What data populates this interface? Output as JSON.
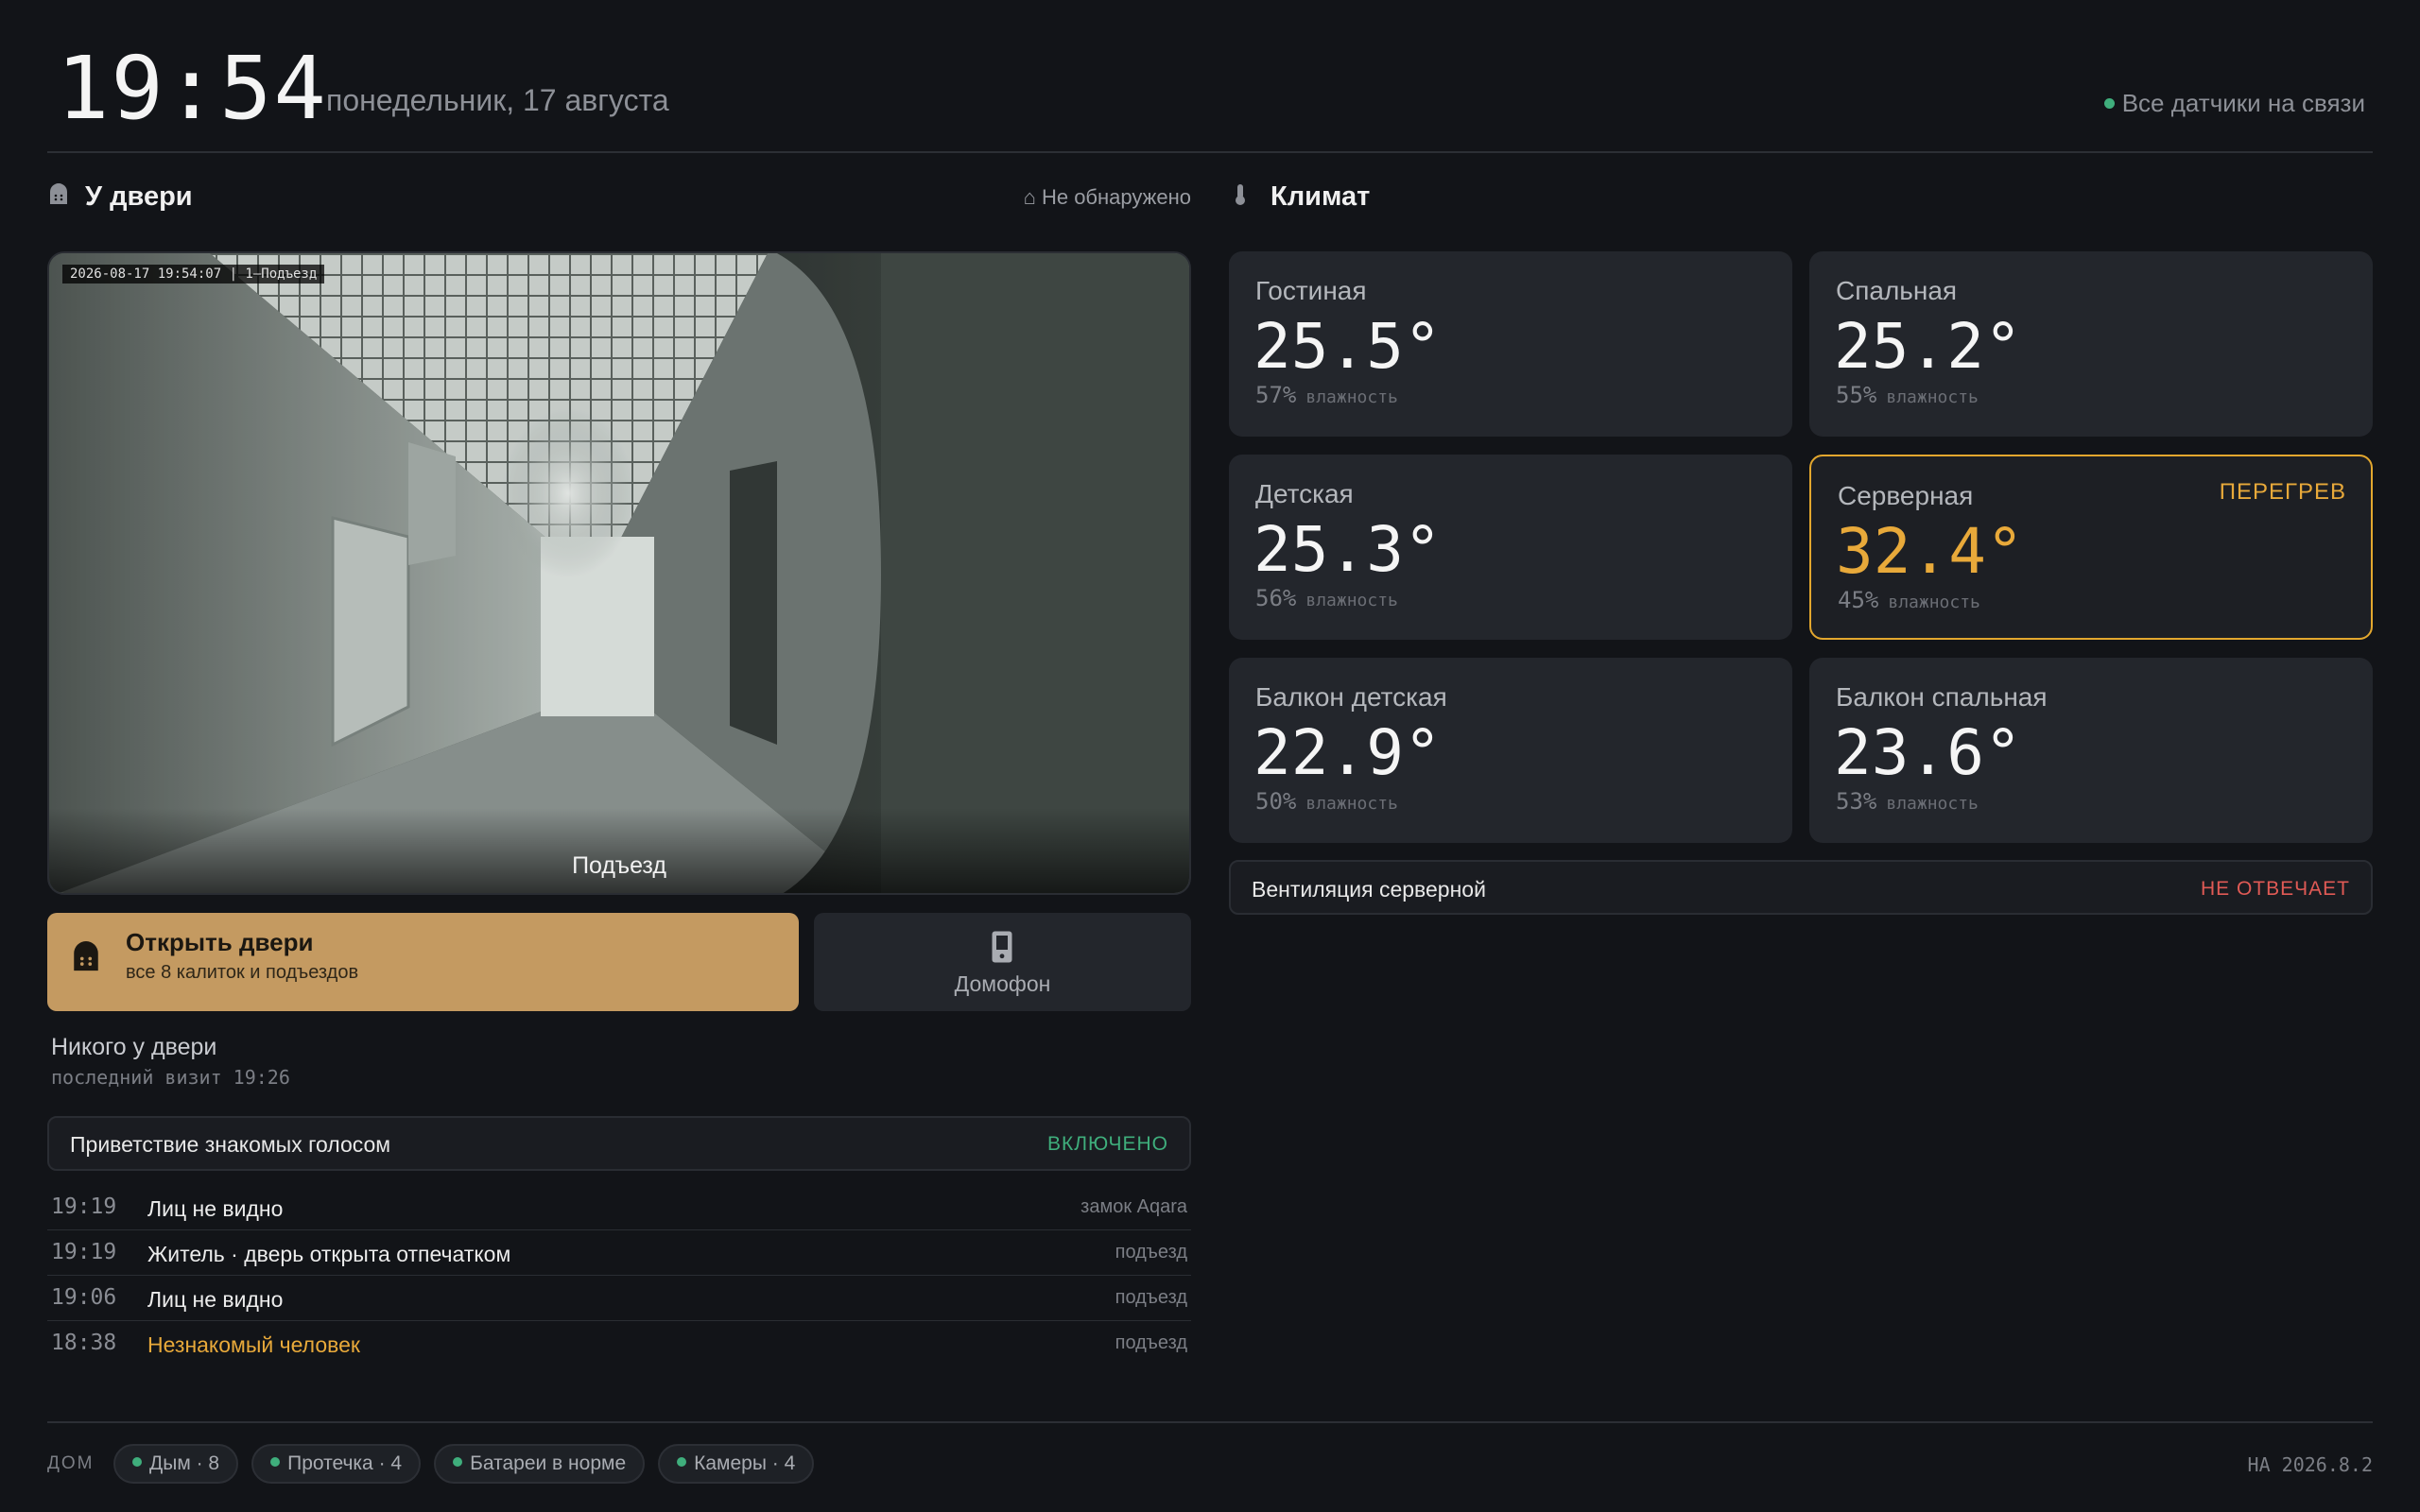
{
  "header": {
    "time": "19:54",
    "date": "понедельник, 17 августа",
    "sensors_status": "Все датчики на связи",
    "sensors_status_color": "#3fae7c"
  },
  "door": {
    "title": "У двери",
    "icon": "door-icon",
    "detection": "⌂ Не обнаружено",
    "camera": {
      "timestamp": "2026-08-17 19:54:07 | 1–Подъезд",
      "label": "Подъезд"
    },
    "open_button": {
      "title": "Открыть двери",
      "subtitle": "все 8 калиток и подъездов",
      "icon": "gate-icon",
      "color": "#c49a61"
    },
    "intercom_button": {
      "label": "Домофон",
      "icon": "intercom-icon"
    },
    "visitor_status": "Никого у двери",
    "last_visit": "последний визит 19:26",
    "greeting": {
      "label": "Приветствие знакомых голосом",
      "state": "ВКЛЮЧЕНО"
    },
    "events": [
      {
        "time": "19:19",
        "text": "Лиц не видно",
        "source": "замок Aqara",
        "warn": false
      },
      {
        "time": "19:19",
        "text": "Житель · дверь открыта отпечатком",
        "source": "подъезд",
        "warn": false
      },
      {
        "time": "19:06",
        "text": "Лиц не видно",
        "source": "подъезд",
        "warn": false
      },
      {
        "time": "18:38",
        "text": "Незнакомый человек",
        "source": "подъезд",
        "warn": true
      }
    ]
  },
  "climate": {
    "title": "Климат",
    "icon": "thermometer-icon",
    "humidity_label": "влажность",
    "rooms": [
      {
        "name": "Гостиная",
        "temp": "25.5°",
        "humidity": "57%",
        "alert": ""
      },
      {
        "name": "Спальная",
        "temp": "25.2°",
        "humidity": "55%",
        "alert": ""
      },
      {
        "name": "Детская",
        "temp": "25.3°",
        "humidity": "56%",
        "alert": ""
      },
      {
        "name": "Серверная",
        "temp": "32.4°",
        "humidity": "45%",
        "alert": "ПЕРЕГРЕВ"
      },
      {
        "name": "Балкон детская",
        "temp": "22.9°",
        "humidity": "50%",
        "alert": ""
      },
      {
        "name": "Балкон спальная",
        "temp": "23.6°",
        "humidity": "53%",
        "alert": ""
      }
    ],
    "ventilation": {
      "label": "Вентиляция серверной",
      "state": "НЕ ОТВЕЧАЕТ",
      "state_color": "#e05a55"
    },
    "alert_color": "#e8a93a"
  },
  "footer": {
    "home_label": "ДОМ",
    "chips": [
      "Дым · 8",
      "Протечка · 4",
      "Батареи в норме",
      "Камеры · 4"
    ],
    "version": "HA 2026.8.2"
  }
}
